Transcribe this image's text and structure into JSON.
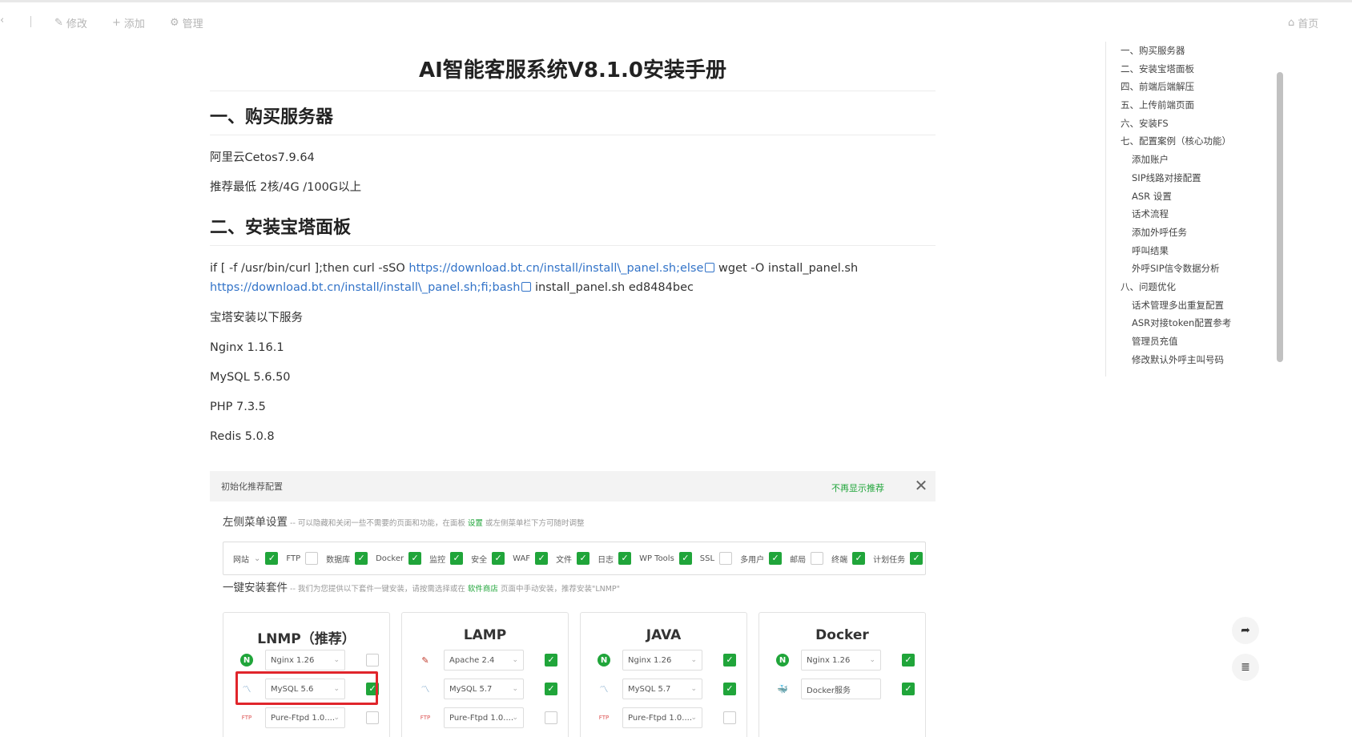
{
  "toolbar": {
    "back_glyph": "‹",
    "edit_label": "修改",
    "add_label": "添加",
    "manage_label": "管理",
    "home_label": "首页"
  },
  "article": {
    "title": "AI智能客服系统V8.1.0安装手册",
    "h1": "一、购买服务器",
    "p1": "阿里云Cetos7.9.64",
    "p2": "推荐最低 2核/4G /100G以上",
    "h2": "二、安装宝塔面板",
    "cmd_part1": "if [ -f /usr/bin/curl ];then curl -sSO ",
    "cmd_link1": "https://download.bt.cn/install/install\\_panel.sh;else",
    "cmd_part2": " wget -O install_panel.sh",
    "cmd_link2": "https://download.bt.cn/install/install\\_panel.sh;fi;bash",
    "cmd_part3": " install_panel.sh ed8484bec",
    "p3": "宝塔安装以下服务",
    "s1": "Nginx 1.16.1",
    "s2": "MySQL 5.6.50",
    "s3": "PHP 7.3.5",
    "s4": "Redis 5.0.8"
  },
  "panel": {
    "header": "初始化推荐配置",
    "no_show": "不再显示推荐",
    "close": "✕",
    "menu_title": "左侧菜单设置",
    "menu_hint_a": " -- 可以隐藏和关闭一些不需要的页面和功能，在面板 ",
    "menu_hint_link": "设置",
    "menu_hint_b": " 或左侧菜单栏下方可随时调整",
    "menu_items": [
      {
        "label": "网站",
        "on": true,
        "dropdown": true
      },
      {
        "label": "FTP",
        "on": false
      },
      {
        "label": "数据库",
        "on": true
      },
      {
        "label": "Docker",
        "on": true
      },
      {
        "label": "监控",
        "on": true
      },
      {
        "label": "安全",
        "on": true
      },
      {
        "label": "WAF",
        "on": true
      },
      {
        "label": "文件",
        "on": true
      },
      {
        "label": "日志",
        "on": true
      },
      {
        "label": "WP Tools",
        "on": true
      },
      {
        "label": "SSL",
        "on": false
      },
      {
        "label": "多用户",
        "on": true
      },
      {
        "label": "邮局",
        "on": false
      },
      {
        "label": "终端",
        "on": true
      },
      {
        "label": "计划任务",
        "on": true
      }
    ],
    "suite_title": "一键安装套件",
    "suite_hint_a": " -- 我们为您提供以下套件一键安装，请按需选择或在 ",
    "suite_hint_link": "软件商店",
    "suite_hint_b": " 页面中手动安装，推荐安装\"LNMP\"",
    "cards": [
      {
        "title": "LNMP（推荐）",
        "rows": [
          {
            "icon": "N",
            "value": "Nginx 1.26",
            "on": false
          },
          {
            "icon": "〽",
            "value": "MySQL 5.6",
            "on": true
          },
          {
            "icon": "FTP",
            "value": "Pure-Ftpd 1.0....",
            "on": false
          }
        ]
      },
      {
        "title": "LAMP",
        "rows": [
          {
            "icon": "✎",
            "value": "Apache 2.4",
            "on": true
          },
          {
            "icon": "〽",
            "value": "MySQL 5.7",
            "on": true
          },
          {
            "icon": "FTP",
            "value": "Pure-Ftpd 1.0....",
            "on": false
          }
        ]
      },
      {
        "title": "JAVA",
        "rows": [
          {
            "icon": "N",
            "value": "Nginx 1.26",
            "on": true
          },
          {
            "icon": "〽",
            "value": "MySQL 5.7",
            "on": true
          },
          {
            "icon": "FTP",
            "value": "Pure-Ftpd 1.0....",
            "on": false
          }
        ]
      },
      {
        "title": "Docker",
        "rows": [
          {
            "icon": "N",
            "value": "Nginx 1.26",
            "on": true
          },
          {
            "icon": "🐳",
            "value": "Docker服务",
            "on": true
          }
        ]
      }
    ]
  },
  "toc": [
    {
      "label": "一、购买服务器",
      "level": 1
    },
    {
      "label": "二、安装宝塔面板",
      "level": 1
    },
    {
      "label": "四、前端后端解压",
      "level": 1
    },
    {
      "label": "五、上传前端页面",
      "level": 1
    },
    {
      "label": "六、安装FS",
      "level": 1
    },
    {
      "label": "七、配置案例（核心功能）",
      "level": 1
    },
    {
      "label": "添加账户",
      "level": 2
    },
    {
      "label": "SIP线路对接配置",
      "level": 2
    },
    {
      "label": "ASR 设置",
      "level": 2
    },
    {
      "label": "话术流程",
      "level": 2
    },
    {
      "label": "添加外呼任务",
      "level": 2
    },
    {
      "label": "呼叫结果",
      "level": 2
    },
    {
      "label": "外呼SIP信令数据分析",
      "level": 2
    },
    {
      "label": "八、问题优化",
      "level": 1
    },
    {
      "label": "话术管理多出重复配置",
      "level": 2
    },
    {
      "label": "ASR对接token配置参考",
      "level": 2
    },
    {
      "label": "管理员充值",
      "level": 2
    },
    {
      "label": "修改默认外呼主叫号码",
      "level": 2
    }
  ],
  "colors": {
    "accent_green": "#20a53a",
    "link_blue": "#3273c8",
    "highlight_red": "#e0252b"
  }
}
